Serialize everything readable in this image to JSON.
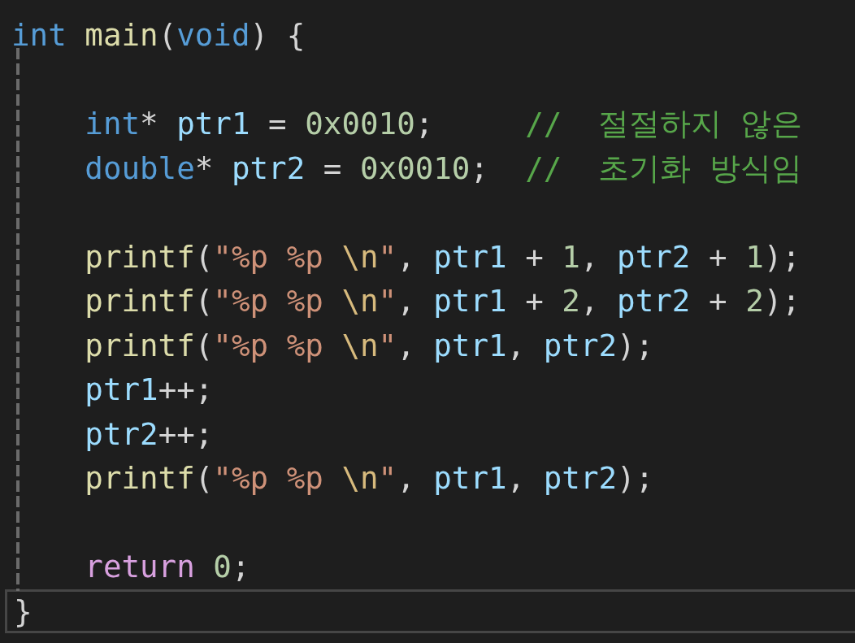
{
  "editor": {
    "lines": [
      {
        "kind": "code",
        "current": false,
        "tokens": [
          {
            "text": "int",
            "kind": "keyword"
          },
          {
            "text": " main",
            "kind": "function"
          },
          {
            "text": "(",
            "kind": "punct"
          },
          {
            "text": "void",
            "kind": "keyword"
          },
          {
            "text": ") {",
            "kind": "punct"
          }
        ]
      },
      {
        "kind": "blank",
        "current": false
      },
      {
        "kind": "code",
        "current": false,
        "tokens": [
          {
            "text": "    int",
            "kind": "keyword"
          },
          {
            "text": "* ",
            "kind": "punct"
          },
          {
            "text": "ptr1",
            "kind": "variable"
          },
          {
            "text": " = ",
            "kind": "punct"
          },
          {
            "text": "0x0010",
            "kind": "number"
          },
          {
            "text": ";     ",
            "kind": "punct"
          },
          {
            "text": "//  절절하지 않은",
            "kind": "comment"
          }
        ]
      },
      {
        "kind": "code",
        "current": false,
        "tokens": [
          {
            "text": "    double",
            "kind": "keyword"
          },
          {
            "text": "* ",
            "kind": "punct"
          },
          {
            "text": "ptr2",
            "kind": "variable"
          },
          {
            "text": " = ",
            "kind": "punct"
          },
          {
            "text": "0x0010",
            "kind": "number"
          },
          {
            "text": ";  ",
            "kind": "punct"
          },
          {
            "text": "//  초기화 방식임",
            "kind": "comment"
          }
        ]
      },
      {
        "kind": "blank",
        "current": false
      },
      {
        "kind": "code",
        "current": false,
        "tokens": [
          {
            "text": "    printf",
            "kind": "function"
          },
          {
            "text": "(",
            "kind": "punct"
          },
          {
            "text": "\"%p %p ",
            "kind": "string"
          },
          {
            "text": "\\n",
            "kind": "escape"
          },
          {
            "text": "\"",
            "kind": "string"
          },
          {
            "text": ", ",
            "kind": "punct"
          },
          {
            "text": "ptr1",
            "kind": "variable"
          },
          {
            "text": " + ",
            "kind": "punct"
          },
          {
            "text": "1",
            "kind": "number"
          },
          {
            "text": ", ",
            "kind": "punct"
          },
          {
            "text": "ptr2",
            "kind": "variable"
          },
          {
            "text": " + ",
            "kind": "punct"
          },
          {
            "text": "1",
            "kind": "number"
          },
          {
            "text": ");",
            "kind": "punct"
          }
        ]
      },
      {
        "kind": "code",
        "current": false,
        "tokens": [
          {
            "text": "    printf",
            "kind": "function"
          },
          {
            "text": "(",
            "kind": "punct"
          },
          {
            "text": "\"%p %p ",
            "kind": "string"
          },
          {
            "text": "\\n",
            "kind": "escape"
          },
          {
            "text": "\"",
            "kind": "string"
          },
          {
            "text": ", ",
            "kind": "punct"
          },
          {
            "text": "ptr1",
            "kind": "variable"
          },
          {
            "text": " + ",
            "kind": "punct"
          },
          {
            "text": "2",
            "kind": "number"
          },
          {
            "text": ", ",
            "kind": "punct"
          },
          {
            "text": "ptr2",
            "kind": "variable"
          },
          {
            "text": " + ",
            "kind": "punct"
          },
          {
            "text": "2",
            "kind": "number"
          },
          {
            "text": ");",
            "kind": "punct"
          }
        ]
      },
      {
        "kind": "code",
        "current": false,
        "tokens": [
          {
            "text": "    printf",
            "kind": "function"
          },
          {
            "text": "(",
            "kind": "punct"
          },
          {
            "text": "\"%p %p ",
            "kind": "string"
          },
          {
            "text": "\\n",
            "kind": "escape"
          },
          {
            "text": "\"",
            "kind": "string"
          },
          {
            "text": ", ",
            "kind": "punct"
          },
          {
            "text": "ptr1",
            "kind": "variable"
          },
          {
            "text": ", ",
            "kind": "punct"
          },
          {
            "text": "ptr2",
            "kind": "variable"
          },
          {
            "text": ");",
            "kind": "punct"
          }
        ]
      },
      {
        "kind": "code",
        "current": false,
        "tokens": [
          {
            "text": "    ptr1",
            "kind": "variable"
          },
          {
            "text": "++;",
            "kind": "punct"
          }
        ]
      },
      {
        "kind": "code",
        "current": false,
        "tokens": [
          {
            "text": "    ptr2",
            "kind": "variable"
          },
          {
            "text": "++;",
            "kind": "punct"
          }
        ]
      },
      {
        "kind": "code",
        "current": false,
        "tokens": [
          {
            "text": "    printf",
            "kind": "function"
          },
          {
            "text": "(",
            "kind": "punct"
          },
          {
            "text": "\"%p %p ",
            "kind": "string"
          },
          {
            "text": "\\n",
            "kind": "escape"
          },
          {
            "text": "\"",
            "kind": "string"
          },
          {
            "text": ", ",
            "kind": "punct"
          },
          {
            "text": "ptr1",
            "kind": "variable"
          },
          {
            "text": ", ",
            "kind": "punct"
          },
          {
            "text": "ptr2",
            "kind": "variable"
          },
          {
            "text": ");",
            "kind": "punct"
          }
        ]
      },
      {
        "kind": "blank",
        "current": false
      },
      {
        "kind": "code",
        "current": false,
        "tokens": [
          {
            "text": "    return",
            "kind": "control"
          },
          {
            "text": " 0",
            "kind": "number"
          },
          {
            "text": ";",
            "kind": "punct"
          }
        ]
      },
      {
        "kind": "code",
        "current": true,
        "tokens": [
          {
            "text": "}",
            "kind": "punct"
          }
        ]
      }
    ]
  }
}
